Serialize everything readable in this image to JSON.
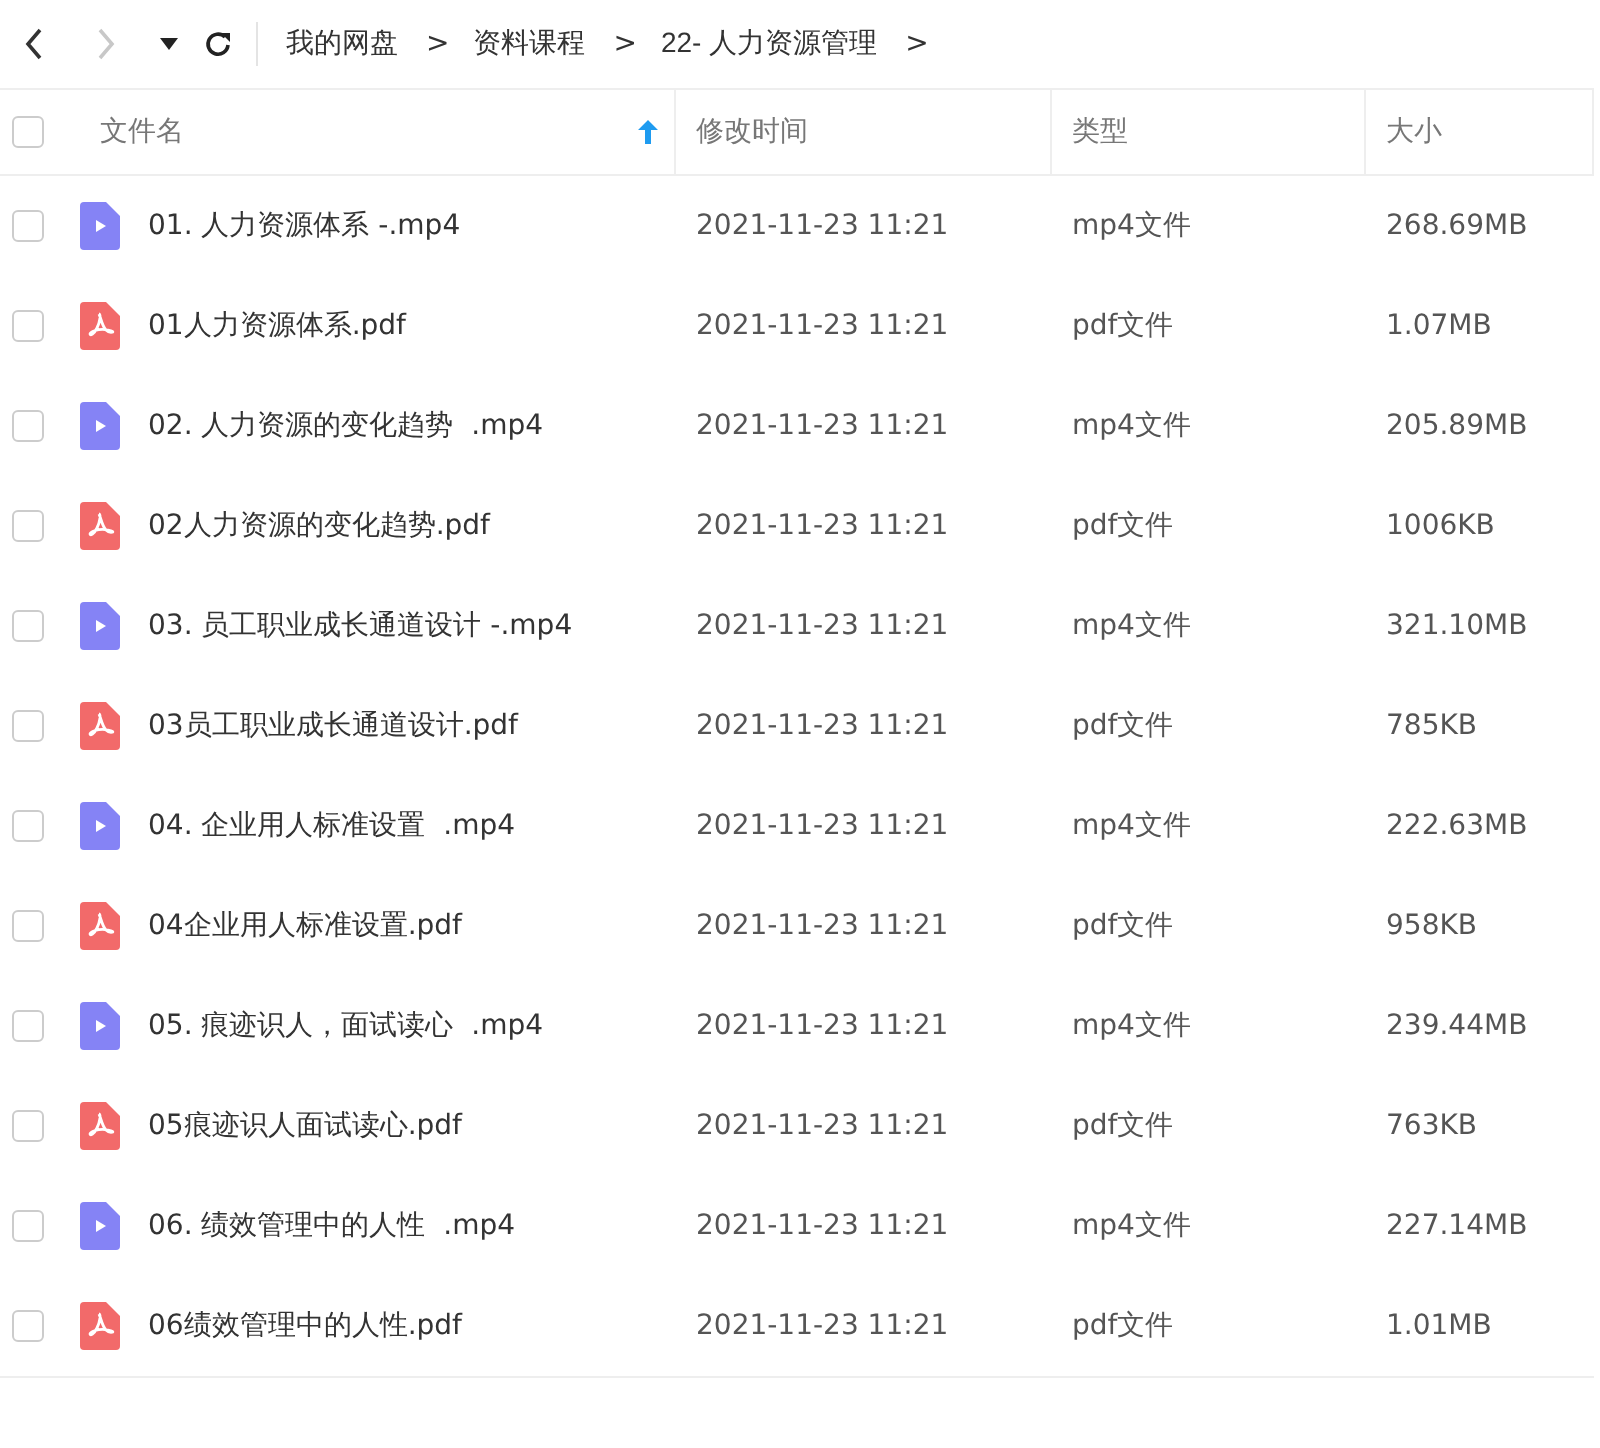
{
  "toolbar": {
    "back": {
      "disabled": false
    },
    "forward": {
      "disabled": true
    },
    "breadcrumbs": [
      {
        "label": "我的网盘",
        "separator": ">"
      },
      {
        "label": "资料课程",
        "separator": ">"
      },
      {
        "label": "22- 人力资源管理",
        "separator": ">"
      }
    ]
  },
  "table": {
    "select_all": {
      "checked": false
    },
    "columns": [
      {
        "label": "文件名",
        "sorted": true
      },
      {
        "label": "修改时间",
        "sorted": false
      },
      {
        "label": "类型",
        "sorted": false
      },
      {
        "label": "大小",
        "sorted": false
      }
    ],
    "rows": [
      {
        "kind": "video",
        "checked": false,
        "name": "01. 人力资源体系 -.mp4",
        "modified": "2021-11-23 11:21",
        "type": "mp4文件",
        "size": "268.69MB"
      },
      {
        "kind": "pdf",
        "checked": false,
        "name": "01人力资源体系.pdf",
        "modified": "2021-11-23 11:21",
        "type": "pdf文件",
        "size": "1.07MB"
      },
      {
        "kind": "video",
        "checked": false,
        "name": "02. 人力资源的变化趋势  .mp4",
        "modified": "2021-11-23 11:21",
        "type": "mp4文件",
        "size": "205.89MB"
      },
      {
        "kind": "pdf",
        "checked": false,
        "name": "02人力资源的变化趋势.pdf",
        "modified": "2021-11-23 11:21",
        "type": "pdf文件",
        "size": "1006KB"
      },
      {
        "kind": "video",
        "checked": false,
        "name": "03. 员工职业成长通道设计 -.mp4",
        "modified": "2021-11-23 11:21",
        "type": "mp4文件",
        "size": "321.10MB"
      },
      {
        "kind": "pdf",
        "checked": false,
        "name": "03员工职业成长通道设计.pdf",
        "modified": "2021-11-23 11:21",
        "type": "pdf文件",
        "size": "785KB"
      },
      {
        "kind": "video",
        "checked": false,
        "name": "04. 企业用人标准设置  .mp4",
        "modified": "2021-11-23 11:21",
        "type": "mp4文件",
        "size": "222.63MB"
      },
      {
        "kind": "pdf",
        "checked": false,
        "name": "04企业用人标准设置.pdf",
        "modified": "2021-11-23 11:21",
        "type": "pdf文件",
        "size": "958KB"
      },
      {
        "kind": "video",
        "checked": false,
        "name": "05. 痕迹识人，面试读心  .mp4",
        "modified": "2021-11-23 11:21",
        "type": "mp4文件",
        "size": "239.44MB"
      },
      {
        "kind": "pdf",
        "checked": false,
        "name": "05痕迹识人面试读心.pdf",
        "modified": "2021-11-23 11:21",
        "type": "pdf文件",
        "size": "763KB"
      },
      {
        "kind": "video",
        "checked": false,
        "name": "06. 绩效管理中的人性  .mp4",
        "modified": "2021-11-23 11:21",
        "type": "mp4文件",
        "size": "227.14MB"
      },
      {
        "kind": "pdf",
        "checked": false,
        "name": "06绩效管理中的人性.pdf",
        "modified": "2021-11-23 11:21",
        "type": "pdf文件",
        "size": "1.01MB"
      }
    ]
  }
}
